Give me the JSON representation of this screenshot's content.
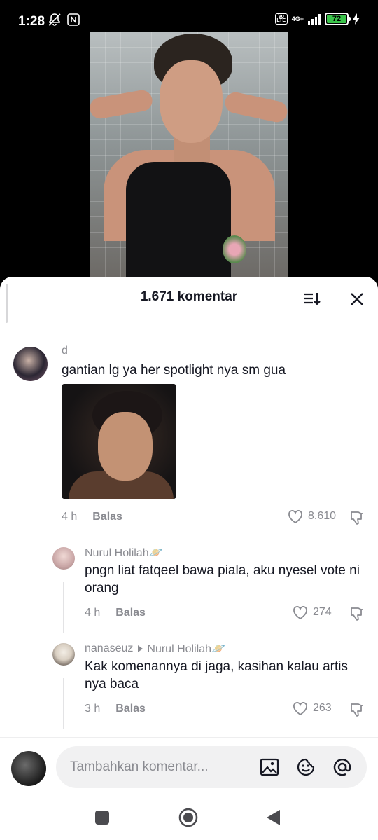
{
  "status_bar": {
    "time": "1:28",
    "volte": "Vo LTE",
    "network": "4G+",
    "battery": "72"
  },
  "sheet": {
    "title": "1.671 komentar"
  },
  "comments": [
    {
      "username": "d",
      "text": "gantian lg ya her spotlight nya sm gua",
      "time": "4 h",
      "reply": "Balas",
      "likes": "8.610",
      "has_image": true
    }
  ],
  "replies": [
    {
      "username": "Nurul Holilah🪐",
      "text": "pngn liat fatqeel bawa piala, aku nyesel vote ni orang",
      "time": "4 h",
      "reply": "Balas",
      "likes": "274"
    },
    {
      "username": "nanaseuz",
      "reply_to": "Nurul Holilah🪐",
      "text": "Kak komenannya di jaga, kasihan kalau artis nya baca",
      "time": "3 h",
      "reply": "Balas",
      "likes": "263"
    }
  ],
  "input": {
    "placeholder": "Tambahkan komentar..."
  },
  "icons": {
    "sort": "sort-icon",
    "close": "close-icon",
    "like": "heart-icon",
    "dislike": "thumbs-down-icon",
    "image": "image-icon",
    "emoji": "emoji-icon",
    "mention": "at-icon"
  },
  "colors": {
    "battery": "#3ac34a",
    "text_primary": "#161823",
    "text_secondary": "#8a8b91"
  }
}
